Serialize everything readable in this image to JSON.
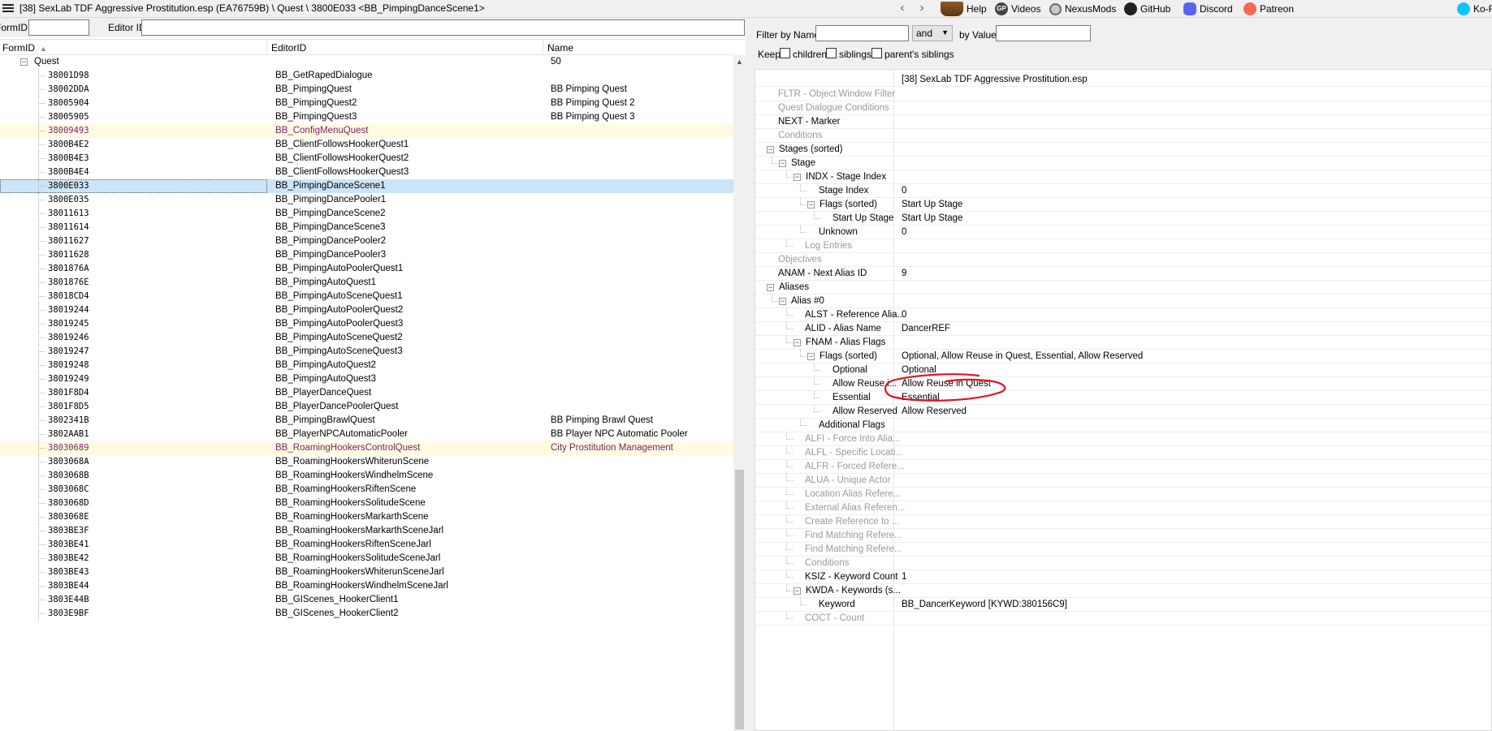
{
  "titlebar": {
    "title": "[38] SexLab TDF Aggressive Prostitution.esp (EA76759B) \\ Quest \\ 3800E033 <BB_PimpingDanceScene1>",
    "back_glyph": "‹",
    "forward_glyph": "›",
    "links": [
      {
        "label": "Help",
        "icon": "book-icon"
      },
      {
        "label": "Videos",
        "icon": "gp-icon"
      },
      {
        "label": "NexusMods",
        "icon": "nexusmods-icon"
      },
      {
        "label": "GitHub",
        "icon": "github-icon"
      },
      {
        "label": "Discord",
        "icon": "discord-icon"
      },
      {
        "label": "Patreon",
        "icon": "patreon-icon"
      },
      {
        "label": "Ko-F",
        "icon": "kofi-icon"
      }
    ]
  },
  "left_filter": {
    "formid_label": "FormID",
    "formid_value": "",
    "editorid_label": "Editor ID",
    "editorid_value": ""
  },
  "left_list": {
    "columns": [
      "FormID",
      "EditorID",
      "Name"
    ],
    "group": {
      "label": "Quest",
      "count": "50"
    },
    "rows": [
      {
        "formid": "38001D98",
        "editorid": "BB_GetRapedDialogue",
        "name": "",
        "state": ""
      },
      {
        "formid": "38002DDA",
        "editorid": "BB_PimpingQuest",
        "name": "BB Pimping Quest",
        "state": ""
      },
      {
        "formid": "38005904",
        "editorid": "BB_PimpingQuest2",
        "name": "BB Pimping Quest 2",
        "state": ""
      },
      {
        "formid": "38005905",
        "editorid": "BB_PimpingQuest3",
        "name": "BB Pimping Quest 3",
        "state": ""
      },
      {
        "formid": "38009493",
        "editorid": "BB_ConfigMenuQuest",
        "name": "",
        "state": "hl"
      },
      {
        "formid": "3800B4E2",
        "editorid": "BB_ClientFollowsHookerQuest1",
        "name": "",
        "state": ""
      },
      {
        "formid": "3800B4E3",
        "editorid": "BB_ClientFollowsHookerQuest2",
        "name": "",
        "state": ""
      },
      {
        "formid": "3800B4E4",
        "editorid": "BB_ClientFollowsHookerQuest3",
        "name": "",
        "state": ""
      },
      {
        "formid": "3800E033",
        "editorid": "BB_PimpingDanceScene1",
        "name": "",
        "state": "sel"
      },
      {
        "formid": "3800E035",
        "editorid": "BB_PimpingDancePooler1",
        "name": "",
        "state": ""
      },
      {
        "formid": "38011613",
        "editorid": "BB_PimpingDanceScene2",
        "name": "",
        "state": ""
      },
      {
        "formid": "38011614",
        "editorid": "BB_PimpingDanceScene3",
        "name": "",
        "state": ""
      },
      {
        "formid": "38011627",
        "editorid": "BB_PimpingDancePooler2",
        "name": "",
        "state": ""
      },
      {
        "formid": "38011628",
        "editorid": "BB_PimpingDancePooler3",
        "name": "",
        "state": ""
      },
      {
        "formid": "3801876A",
        "editorid": "BB_PimpingAutoPoolerQuest1",
        "name": "",
        "state": ""
      },
      {
        "formid": "3801876E",
        "editorid": "BB_PimpingAutoQuest1",
        "name": "",
        "state": ""
      },
      {
        "formid": "38018CD4",
        "editorid": "BB_PimpingAutoSceneQuest1",
        "name": "",
        "state": ""
      },
      {
        "formid": "38019244",
        "editorid": "BB_PimpingAutoPoolerQuest2",
        "name": "",
        "state": ""
      },
      {
        "formid": "38019245",
        "editorid": "BB_PimpingAutoPoolerQuest3",
        "name": "",
        "state": ""
      },
      {
        "formid": "38019246",
        "editorid": "BB_PimpingAutoSceneQuest2",
        "name": "",
        "state": ""
      },
      {
        "formid": "38019247",
        "editorid": "BB_PimpingAutoSceneQuest3",
        "name": "",
        "state": ""
      },
      {
        "formid": "38019248",
        "editorid": "BB_PimpingAutoQuest2",
        "name": "",
        "state": ""
      },
      {
        "formid": "38019249",
        "editorid": "BB_PimpingAutoQuest3",
        "name": "",
        "state": ""
      },
      {
        "formid": "3801F8D4",
        "editorid": "BB_PlayerDanceQuest",
        "name": "",
        "state": ""
      },
      {
        "formid": "3801F8D5",
        "editorid": "BB_PlayerDancePoolerQuest",
        "name": "",
        "state": ""
      },
      {
        "formid": "3802341B",
        "editorid": "BB_PimpingBrawlQuest",
        "name": "BB Pimping Brawl Quest",
        "state": ""
      },
      {
        "formid": "3802AAB1",
        "editorid": "BB_PlayerNPCAutomaticPooler",
        "name": "BB Player NPC Automatic Pooler",
        "state": ""
      },
      {
        "formid": "38030689",
        "editorid": "BB_RoamingHookersControlQuest",
        "name": "City Prostitution Management",
        "state": "hl"
      },
      {
        "formid": "3803068A",
        "editorid": "BB_RoamingHookersWhiterunScene",
        "name": "",
        "state": ""
      },
      {
        "formid": "3803068B",
        "editorid": "BB_RoamingHookersWindhelmScene",
        "name": "",
        "state": ""
      },
      {
        "formid": "3803068C",
        "editorid": "BB_RoamingHookersRiftenScene",
        "name": "",
        "state": ""
      },
      {
        "formid": "3803068D",
        "editorid": "BB_RoamingHookersSolitudeScene",
        "name": "",
        "state": ""
      },
      {
        "formid": "3803068E",
        "editorid": "BB_RoamingHookersMarkarthScene",
        "name": "",
        "state": ""
      },
      {
        "formid": "3803BE3F",
        "editorid": "BB_RoamingHookersMarkarthSceneJarl",
        "name": "",
        "state": ""
      },
      {
        "formid": "3803BE41",
        "editorid": "BB_RoamingHookersRiftenSceneJarl",
        "name": "",
        "state": ""
      },
      {
        "formid": "3803BE42",
        "editorid": "BB_RoamingHookersSolitudeSceneJarl",
        "name": "",
        "state": ""
      },
      {
        "formid": "3803BE43",
        "editorid": "BB_RoamingHookersWhiterunSceneJarl",
        "name": "",
        "state": ""
      },
      {
        "formid": "3803BE44",
        "editorid": "BB_RoamingHookersWindhelmSceneJarl",
        "name": "",
        "state": ""
      },
      {
        "formid": "3803E44B",
        "editorid": "BB_GIScenes_HookerClient1",
        "name": "",
        "state": ""
      },
      {
        "formid": "3803E9BF",
        "editorid": "BB_GIScenes_HookerClient2",
        "name": "",
        "state": ""
      }
    ]
  },
  "right_filter": {
    "filter_by_name_label": "Filter by Name:",
    "name_value": "",
    "operator": "and",
    "by_value_label": "by Value:",
    "value_value": "",
    "keep_label": "Keep",
    "checkboxes": [
      "children",
      "siblings",
      "parent's siblings"
    ]
  },
  "record_tree": {
    "header_value": "[38] SexLab TDF Aggressive Prostitution.esp",
    "rows": [
      {
        "indent": 0,
        "expander": "",
        "label": "FLTR - Object Window Filter",
        "value": "",
        "dim": true
      },
      {
        "indent": 0,
        "expander": "",
        "label": "Quest Dialogue Conditions",
        "value": "",
        "dim": true
      },
      {
        "indent": 0,
        "expander": "",
        "label": "NEXT - Marker",
        "value": "",
        "dim": false
      },
      {
        "indent": 0,
        "expander": "",
        "label": "Conditions",
        "value": "",
        "dim": true
      },
      {
        "indent": 0,
        "expander": "−",
        "label": "Stages (sorted)",
        "value": "",
        "dim": false
      },
      {
        "indent": 1,
        "expander": "−",
        "label": "Stage",
        "value": "",
        "dim": false
      },
      {
        "indent": 2,
        "expander": "−",
        "label": "INDX - Stage Index",
        "value": "",
        "dim": false
      },
      {
        "indent": 3,
        "expander": "",
        "label": "Stage Index",
        "value": "0",
        "dim": false
      },
      {
        "indent": 3,
        "expander": "−",
        "label": "Flags (sorted)",
        "value": "Start Up Stage",
        "dim": false
      },
      {
        "indent": 4,
        "expander": "",
        "label": "Start Up Stage",
        "value": "Start Up Stage",
        "dim": false
      },
      {
        "indent": 3,
        "expander": "",
        "label": "Unknown",
        "value": "0",
        "dim": false
      },
      {
        "indent": 2,
        "expander": "",
        "label": "Log Entries",
        "value": "",
        "dim": true
      },
      {
        "indent": 0,
        "expander": "",
        "label": "Objectives",
        "value": "",
        "dim": true
      },
      {
        "indent": 0,
        "expander": "",
        "label": "ANAM - Next Alias ID",
        "value": "9",
        "dim": false
      },
      {
        "indent": 0,
        "expander": "−",
        "label": "Aliases",
        "value": "",
        "dim": false
      },
      {
        "indent": 1,
        "expander": "−",
        "label": "Alias #0",
        "value": "",
        "dim": false
      },
      {
        "indent": 2,
        "expander": "",
        "label": "ALST - Reference Alia...",
        "value": "0",
        "dim": false
      },
      {
        "indent": 2,
        "expander": "",
        "label": "ALID - Alias Name",
        "value": "DancerREF",
        "dim": false
      },
      {
        "indent": 2,
        "expander": "−",
        "label": "FNAM - Alias Flags",
        "value": "",
        "dim": false
      },
      {
        "indent": 3,
        "expander": "−",
        "label": "Flags (sorted)",
        "value": "Optional, Allow Reuse in Quest, Essential, Allow Reserved",
        "dim": false
      },
      {
        "indent": 4,
        "expander": "",
        "label": "Optional",
        "value": "Optional",
        "dim": false
      },
      {
        "indent": 4,
        "expander": "",
        "label": "Allow Reuse i...",
        "value": "Allow Reuse in Quest",
        "dim": false
      },
      {
        "indent": 4,
        "expander": "",
        "label": "Essential",
        "value": "Essential",
        "dim": false
      },
      {
        "indent": 4,
        "expander": "",
        "label": "Allow Reserved",
        "value": "Allow Reserved",
        "dim": false
      },
      {
        "indent": 3,
        "expander": "",
        "label": "Additional Flags",
        "value": "",
        "dim": false
      },
      {
        "indent": 2,
        "expander": "",
        "label": "ALFI - Force Into Alia...",
        "value": "",
        "dim": true
      },
      {
        "indent": 2,
        "expander": "",
        "label": "ALFL - Specific Locati...",
        "value": "",
        "dim": true
      },
      {
        "indent": 2,
        "expander": "",
        "label": "ALFR - Forced Refere...",
        "value": "",
        "dim": true
      },
      {
        "indent": 2,
        "expander": "",
        "label": "ALUA - Unique Actor",
        "value": "",
        "dim": true
      },
      {
        "indent": 2,
        "expander": "",
        "label": "Location Alias Refere...",
        "value": "",
        "dim": true
      },
      {
        "indent": 2,
        "expander": "",
        "label": "External Alias Referen...",
        "value": "",
        "dim": true
      },
      {
        "indent": 2,
        "expander": "",
        "label": "Create Reference to ...",
        "value": "",
        "dim": true
      },
      {
        "indent": 2,
        "expander": "",
        "label": "Find Matching Refere...",
        "value": "",
        "dim": true
      },
      {
        "indent": 2,
        "expander": "",
        "label": "Find Matching Refere...",
        "value": "",
        "dim": true
      },
      {
        "indent": 2,
        "expander": "",
        "label": "Conditions",
        "value": "",
        "dim": true
      },
      {
        "indent": 2,
        "expander": "",
        "label": "KSIZ - Keyword Count",
        "value": "1",
        "dim": false
      },
      {
        "indent": 2,
        "expander": "−",
        "label": "KWDA - Keywords (s...",
        "value": "",
        "dim": false
      },
      {
        "indent": 3,
        "expander": "",
        "label": "Keyword",
        "value": "BB_DancerKeyword [KYWD:380156C9]",
        "dim": false
      },
      {
        "indent": 2,
        "expander": "",
        "label": "COCT - Count",
        "value": "",
        "dim": true
      }
    ]
  },
  "colors": {
    "highlight_row": "#fffbe0",
    "highlight_text": "#7a1f6a",
    "selected_row": "#cce4f7",
    "annotation_red": "#e0141e"
  }
}
